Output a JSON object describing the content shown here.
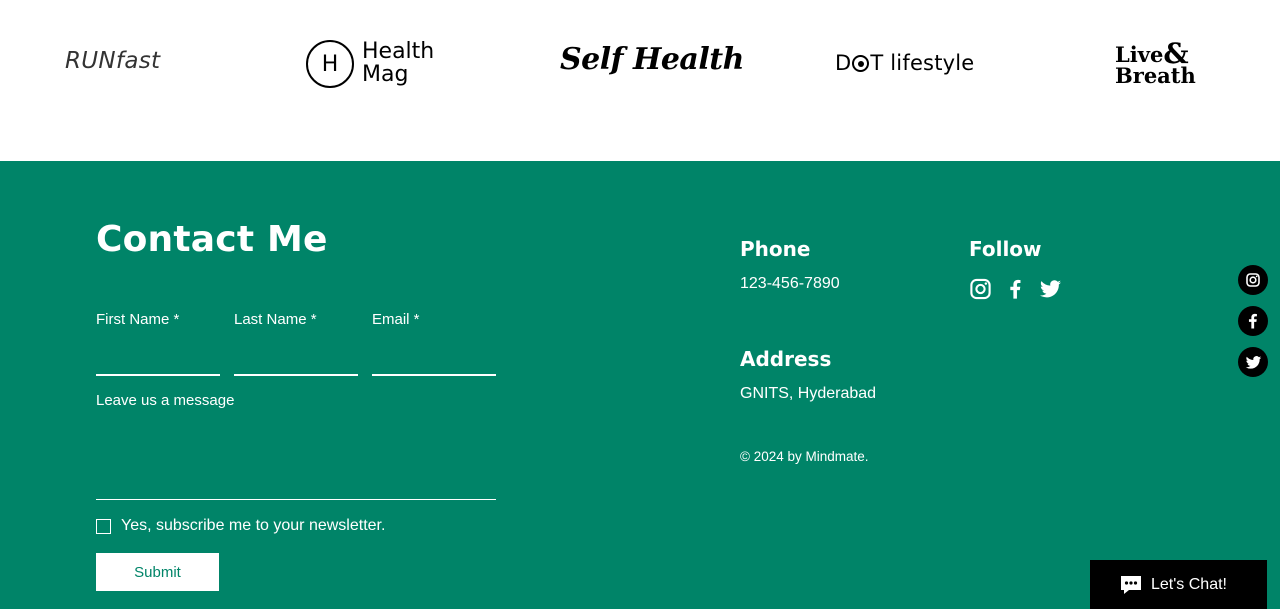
{
  "logos": {
    "runfast": "RUNfast",
    "health_mag_letter": "H",
    "health_mag_line1": "Health",
    "health_mag_line2": "Mag",
    "self_health": "Self Health",
    "dot_lifestyle_d": "D",
    "dot_lifestyle_rest": "T lifestyle",
    "live_breath_line1": "Live",
    "live_breath_amp": "&",
    "live_breath_line2": "Breath"
  },
  "contact": {
    "title": "Contact Me",
    "first_name_label": "First Name *",
    "last_name_label": "Last Name *",
    "email_label": "Email *",
    "message_label": "Leave us a message",
    "newsletter_label": "Yes, subscribe me to your newsletter.",
    "submit_label": "Submit"
  },
  "info": {
    "phone_heading": "Phone",
    "phone_value": "123-456-7890",
    "address_heading": "Address",
    "address_value": "GNITS, Hyderabad",
    "copyright": "© 2024 by Mindmate.",
    "follow_heading": "Follow"
  },
  "chat": {
    "label": "Let's Chat!"
  },
  "colors": {
    "footer_bg": "#008468",
    "text_on_footer": "#ffffff",
    "chat_bg": "#000000"
  },
  "icons": [
    "instagram-icon",
    "facebook-icon",
    "twitter-icon",
    "chat-bubble-icon"
  ]
}
